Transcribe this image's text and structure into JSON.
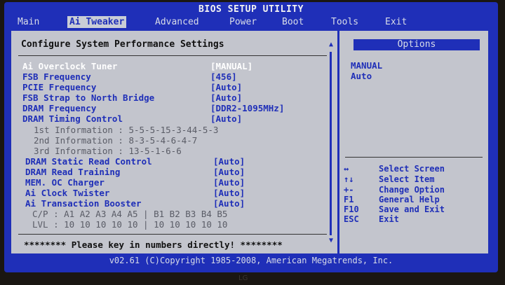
{
  "title": "BIOS SETUP UTILITY",
  "menu": [
    {
      "label": "Main",
      "active": false
    },
    {
      "label": "Ai Tweaker",
      "active": true
    },
    {
      "label": "Advanced",
      "active": false
    },
    {
      "label": "Power",
      "active": false
    },
    {
      "label": "Boot",
      "active": false
    },
    {
      "label": "Tools",
      "active": false
    },
    {
      "label": "Exit",
      "active": false
    }
  ],
  "main": {
    "heading": "Configure System Performance Settings",
    "rows": [
      {
        "label": "Ai Overclock Tuner",
        "value": "[MANUAL]"
      },
      {
        "label": "FSB Frequency",
        "value": "[456]"
      },
      {
        "label": "PCIE Frequency",
        "value": "[Auto]"
      },
      {
        "label": "FSB Strap to North Bridge",
        "value": "[Auto]"
      },
      {
        "label": "DRAM Frequency",
        "value": "[DDR2-1095MHz]"
      },
      {
        "label": "DRAM Timing Control",
        "value": "[Auto]"
      },
      {
        "label": "1st Information : 5-5-5-15-3-44-5-3",
        "value": ""
      },
      {
        "label": "2nd Information : 8-3-5-4-6-4-7",
        "value": ""
      },
      {
        "label": "3rd Information : 13-5-1-6-6",
        "value": ""
      },
      {
        "label": "DRAM Static Read Control",
        "value": "[Auto]"
      },
      {
        "label": "DRAM Read Training",
        "value": "[Auto]"
      },
      {
        "label": "MEM. OC Charger",
        "value": "[Auto]"
      },
      {
        "label": "Ai Clock Twister",
        "value": "[Auto]"
      },
      {
        "label": "Ai Transaction Booster",
        "value": "[Auto]"
      },
      {
        "label": "C/P : A1 A2 A3 A4 A5 | B1 B2 B3 B4 B5",
        "value": ""
      },
      {
        "label": "LVL : 10 10 10 10 10 | 10 10 10 10 10",
        "value": ""
      }
    ],
    "message": "******** Please key in numbers directly! ********"
  },
  "options": {
    "title": "Options",
    "items": [
      "MANUAL",
      "Auto"
    ]
  },
  "help": [
    {
      "key": "↔",
      "desc": "Select Screen"
    },
    {
      "key": "↑↓",
      "desc": "Select Item"
    },
    {
      "key": "+-",
      "desc": "Change Option"
    },
    {
      "key": "F1",
      "desc": "General Help"
    },
    {
      "key": "F10",
      "desc": "Save and Exit"
    },
    {
      "key": "ESC",
      "desc": "Exit"
    }
  ],
  "copyright": "v02.61 (C)Copyright 1985-2008, American Megatrends, Inc.",
  "bezel_logo": "LG",
  "colors": {
    "bios_blue": "#1f2fb8",
    "panel_grey": "#c3c5cd",
    "highlight_white": "#ffffff"
  }
}
